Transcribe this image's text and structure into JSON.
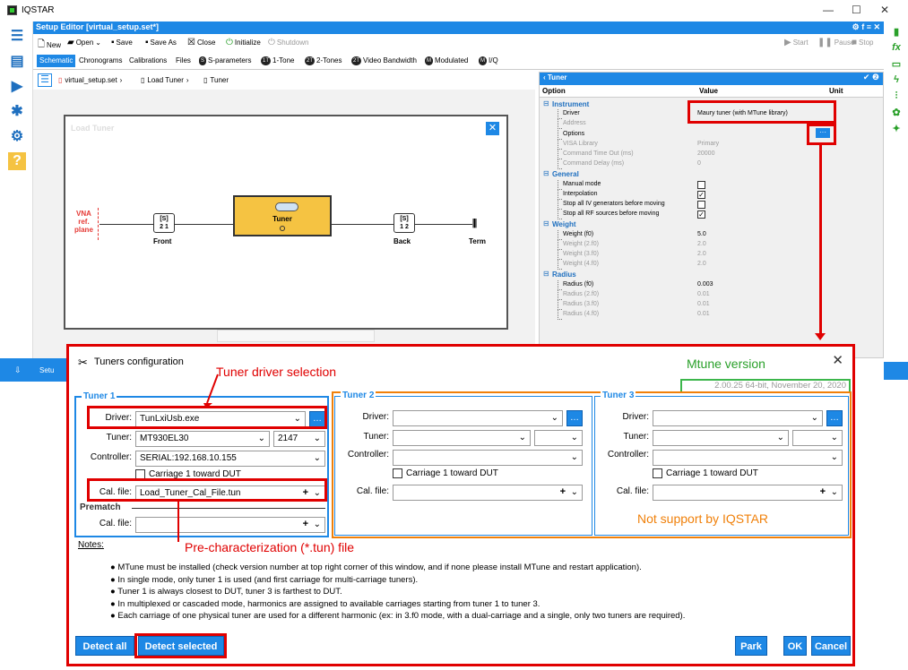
{
  "app": {
    "title": "IQSTAR"
  },
  "window_controls": {
    "minimize": "—",
    "maximize": "☐",
    "close": "✕"
  },
  "editor": {
    "title": "Setup Editor [virtual_setup.set*]",
    "title_icons": "⚙ f ≡ ✕"
  },
  "toolbar": {
    "new": "New",
    "open": "Open",
    "save": "Save",
    "save_as": "Save As",
    "close": "Close",
    "initialize": "Initialize",
    "shutdown": "Shutdown",
    "start": "Start",
    "pause": "Pause",
    "stop": "Stop"
  },
  "tabs": [
    {
      "label": "Schematic",
      "badge": ""
    },
    {
      "label": "Chronograms",
      "badge": ""
    },
    {
      "label": "Calibrations",
      "badge": ""
    },
    {
      "label": "Files",
      "badge": ""
    },
    {
      "label": "S-parameters",
      "badge": "S"
    },
    {
      "label": "1-Tone",
      "badge": "1T"
    },
    {
      "label": "2-Tones",
      "badge": "2T"
    },
    {
      "label": "Video Bandwidth",
      "badge": "2T"
    },
    {
      "label": "Modulated",
      "badge": "M"
    },
    {
      "label": "I/Q",
      "badge": "M"
    }
  ],
  "breadcrumb": [
    "virtual_setup.set",
    "Load Tuner",
    "Tuner"
  ],
  "schematic": {
    "ghost_title": "Load Tuner",
    "vna_label": "VNA\nref.\nplane",
    "front_block": "[S]\n2 1",
    "front_label": "Front",
    "tuner_label": "Tuner",
    "back_block": "[S]\n1 2",
    "back_label": "Back",
    "term_label": "Term"
  },
  "props": {
    "title": "Tuner",
    "header_icons": "✔ ❷",
    "col_option": "Option",
    "col_value": "Value",
    "col_unit": "Unit",
    "rows": [
      {
        "name": "Instrument",
        "value": "",
        "type": "group"
      },
      {
        "name": "Driver",
        "value": "Maury tuner (with MTune library)",
        "type": "row"
      },
      {
        "name": "Address",
        "value": "",
        "type": "dim"
      },
      {
        "name": "Options",
        "value": "",
        "type": "row"
      },
      {
        "name": "VISA Library",
        "value": "Primary",
        "type": "dim"
      },
      {
        "name": "Command Time Out (ms)",
        "value": "20000",
        "type": "dim"
      },
      {
        "name": "Command Delay (ms)",
        "value": "0",
        "type": "dim"
      },
      {
        "name": "General",
        "value": "",
        "type": "group"
      },
      {
        "name": "Manual mode",
        "value": "",
        "type": "cb",
        "checked": false
      },
      {
        "name": "Interpolation",
        "value": "",
        "type": "cb",
        "checked": true
      },
      {
        "name": "Stop all IV generators before moving",
        "value": "",
        "type": "cb",
        "checked": false
      },
      {
        "name": "Stop all RF sources before moving",
        "value": "",
        "type": "cb",
        "checked": true
      },
      {
        "name": "Weight",
        "value": "",
        "type": "group"
      },
      {
        "name": "Weight (f0)",
        "value": "5.0",
        "type": "row"
      },
      {
        "name": "Weight (2.f0)",
        "value": "2.0",
        "type": "dim"
      },
      {
        "name": "Weight (3.f0)",
        "value": "2.0",
        "type": "dim"
      },
      {
        "name": "Weight (4.f0)",
        "value": "2.0",
        "type": "dim"
      },
      {
        "name": "Radius",
        "value": "",
        "type": "group"
      },
      {
        "name": "Radius (f0)",
        "value": "0.003",
        "type": "row"
      },
      {
        "name": "Radius (2.f0)",
        "value": "0.01",
        "type": "dim"
      },
      {
        "name": "Radius (3.f0)",
        "value": "0.01",
        "type": "dim"
      },
      {
        "name": "Radius (4.f0)",
        "value": "0.01",
        "type": "dim"
      }
    ]
  },
  "status": {
    "label": "Setu"
  },
  "dialog": {
    "title": "Tuners configuration",
    "version": "2.00.25 64-bit, November 20, 2020",
    "tuner1": {
      "label": "Tuner 1",
      "driver_label": "Driver:",
      "driver_value": "TunLxiUsb.exe",
      "tuner_label": "Tuner:",
      "tuner_value": "MT930EL30",
      "tuner_sn": "2147",
      "controller_label": "Controller:",
      "controller_value": "SERIAL:192.168.10.155",
      "carriage_label": "Carriage 1 toward DUT",
      "cal_label": "Cal. file:",
      "cal_value": "Load_Tuner_Cal_File.tun"
    },
    "prematch": {
      "label": "Prematch",
      "cal_label": "Cal. file:",
      "cal_value": ""
    },
    "tuner2": {
      "label": "Tuner 2",
      "driver_label": "Driver:",
      "tuner_label": "Tuner:",
      "controller_label": "Controller:",
      "carriage_label": "Carriage 1 toward DUT",
      "cal_label": "Cal. file:"
    },
    "tuner3": {
      "label": "Tuner 3",
      "driver_label": "Driver:",
      "tuner_label": "Tuner:",
      "controller_label": "Controller:",
      "carriage_label": "Carriage 1 toward DUT",
      "cal_label": "Cal. file:"
    },
    "notes_title": "Notes:",
    "notes": [
      "MTune must be installed (check version number at top right corner of this window, and if none please install MTune and restart application).",
      "In single mode, only tuner 1 is used (and first carriage for multi-carriage tuners).",
      "Tuner 1 is always closest to DUT, tuner 3 is farthest to DUT.",
      "In multiplexed or cascaded mode, harmonics are assigned to available carriages starting from tuner 1 to tuner 3.",
      "Each carriage of one physical tuner are used for a different harmonic (ex: in 3.f0 mode, with a dual-carriage and a single, only two tuners are required)."
    ],
    "buttons": {
      "detect_all": "Detect all",
      "detect_selected": "Detect selected",
      "park": "Park",
      "ok": "OK",
      "cancel": "Cancel"
    }
  },
  "annotations": {
    "driver_selection": "Tuner driver selection",
    "mtune_version": "Mtune version",
    "not_support": "Not support by IQSTAR",
    "precharacterization": "Pre-characterization (*.tun) file"
  },
  "colors": {
    "accent": "#1e88e5",
    "highlight_red": "#e00000",
    "highlight_green": "#3cb64b",
    "highlight_orange": "#f0800a",
    "tuner_yellow": "#f5c342"
  }
}
